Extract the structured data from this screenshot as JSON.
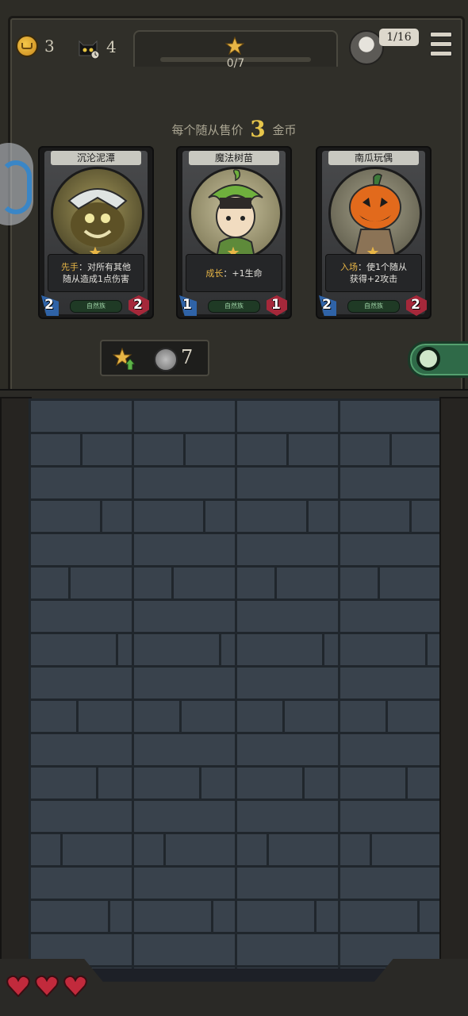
{
  "resources": {
    "coins": "3",
    "cat_count": "4"
  },
  "progress": {
    "stars_text": "0/7",
    "fraction": 0.0
  },
  "player": {
    "rank": "1/16"
  },
  "shop": {
    "price_prefix": "每个随从售价",
    "price_value": "3",
    "price_suffix": "金币",
    "upgrade_cost": "7"
  },
  "cards": [
    {
      "name": "沉沦泥潭",
      "keyword": "先手",
      "text_line1": "：对所有其他",
      "text_line2": "随从造成1点伤害",
      "tribe": "自然族",
      "attack": "2",
      "health": "2",
      "art": "mire-monster"
    },
    {
      "name": "魔法树苗",
      "keyword": "成长",
      "text_line1": "：+1生命",
      "text_line2": "",
      "tribe": "自然族",
      "attack": "1",
      "health": "1",
      "art": "sprout-girl"
    },
    {
      "name": "南瓜玩偶",
      "keyword": "入场",
      "text_line1": "：使1个随从",
      "text_line2": "获得+2攻击",
      "tribe": "自然族",
      "attack": "2",
      "health": "2",
      "art": "pumpkin-head"
    }
  ],
  "lives": {
    "hearts": 3
  },
  "colors": {
    "gold": "#e7c64b",
    "attack_blue": "#2f63a7",
    "health_red": "#a5283a",
    "wall": "#39424c"
  }
}
